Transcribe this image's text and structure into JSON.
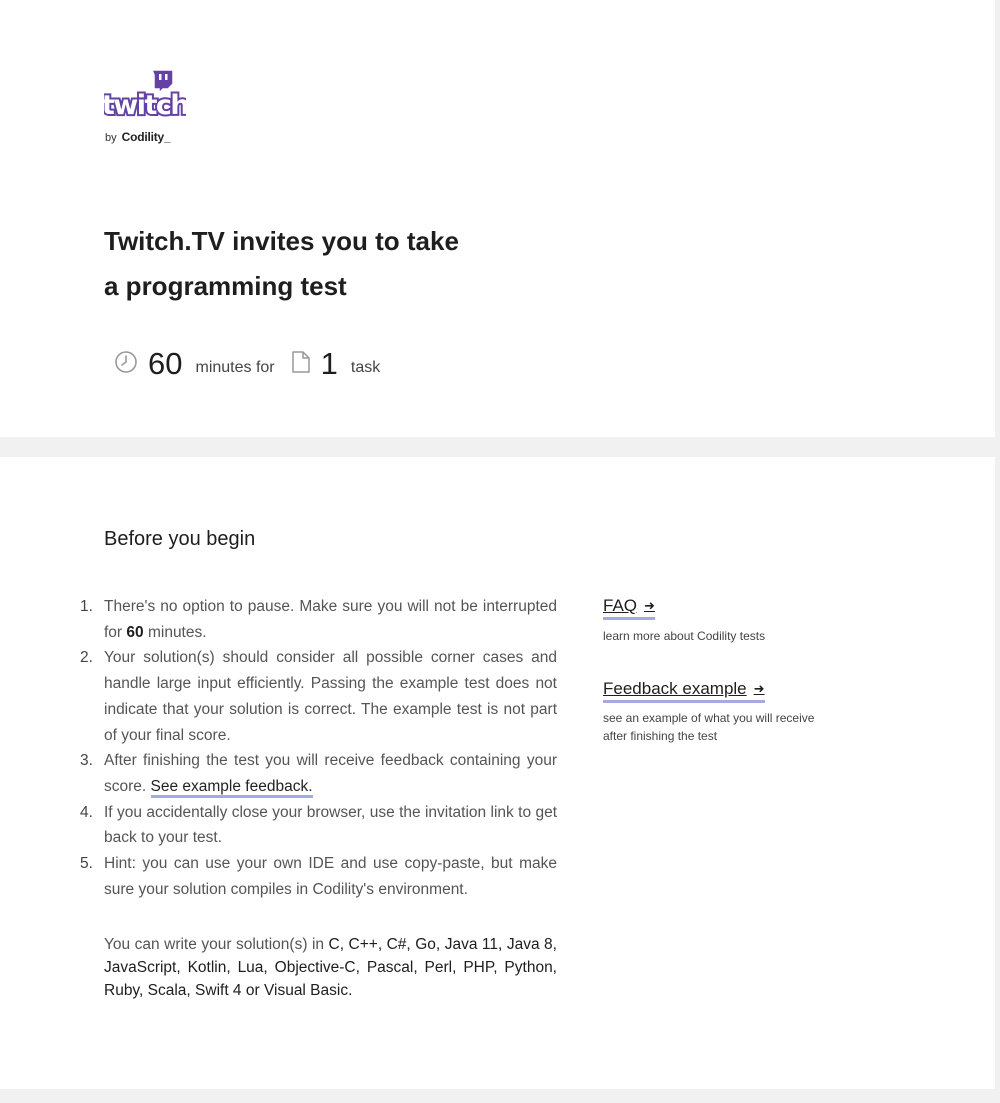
{
  "header": {
    "logo_text": "twitch",
    "by_label": "by",
    "brand_name": "Codility_",
    "title_line1": "Twitch.TV invites you to take",
    "title_line2": "a programming test",
    "stats": {
      "time_icon": "clock-icon",
      "minutes": "60",
      "minutes_label": "minutes for",
      "task_icon": "document-icon",
      "tasks": "1",
      "tasks_label": "task"
    }
  },
  "main": {
    "section_title": "Before you begin",
    "rules": [
      {
        "n": "1.",
        "pre": "There's no option to pause. Make sure you will not be interrupted for ",
        "bold": "60",
        "post": " minutes."
      },
      {
        "n": "2.",
        "text": "Your solution(s) should consider all possible corner cases and handle large input efficiently. Passing the example test does not indicate that your solution is correct. The example test is not part of your final score."
      },
      {
        "n": "3.",
        "pre": "After finishing the test you will receive feedback containing your score. ",
        "link": "See example feedback."
      },
      {
        "n": "4.",
        "text": "If you accidentally close your browser, use the invitation link to get back to your test."
      },
      {
        "n": "5.",
        "text": "Hint: you can use your own IDE and use copy-paste, but make sure your solution compiles in Codility's environment."
      }
    ],
    "languages_intro": "You can write your solution(s) in ",
    "languages_list": "C, C++, C#, Go, Java 11, Java 8, JavaScript, Kotlin, Lua, Objective-C, Pascal, Perl, PHP, Python, Ruby, Scala, Swift 4 or Visual Basic."
  },
  "sidebar": {
    "faq_label": "FAQ",
    "faq_desc": "learn more about Codility tests",
    "feedback_label": "Feedback example",
    "feedback_desc": "see an example of what you will receive after finishing the test",
    "arrow_icon": "arrow-right-icon"
  },
  "colors": {
    "twitch_purple": "#6441a5",
    "link_underline": "#a7a9e3",
    "background": "#f1f1f1"
  }
}
